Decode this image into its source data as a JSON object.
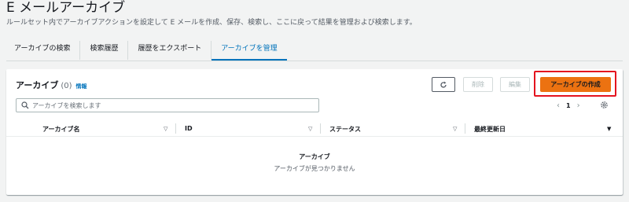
{
  "page": {
    "title": "E メールアーカイブ",
    "description": "ルールセット内でアーカイブアクションを設定して E メールを作成、保存、検索し、ここに戻って結果を管理および検索します。"
  },
  "tabs": [
    {
      "label": "アーカイブの検索"
    },
    {
      "label": "検索履歴"
    },
    {
      "label": "履歴をエクスポート"
    },
    {
      "label": "アーカイブを管理",
      "active": true
    }
  ],
  "panel": {
    "title": "アーカイブ",
    "count": "(0)",
    "info_link": "情報",
    "buttons": {
      "refresh_icon": "refresh-icon",
      "delete": "削除",
      "edit": "編集",
      "create": "アーカイブの作成"
    },
    "search": {
      "placeholder": "アーカイブを検索します"
    },
    "pagination": {
      "prev": "‹",
      "page": "1",
      "next": "›"
    },
    "table": {
      "columns": [
        "アーカイブ名",
        "ID",
        "ステータス",
        "最終更新日"
      ]
    },
    "empty": {
      "title": "アーカイブ",
      "description": "アーカイブが見つかりません"
    }
  },
  "colors": {
    "primary_button": "#ec7211",
    "highlight_border": "#e4141f",
    "active_tab": "#0073bb"
  }
}
